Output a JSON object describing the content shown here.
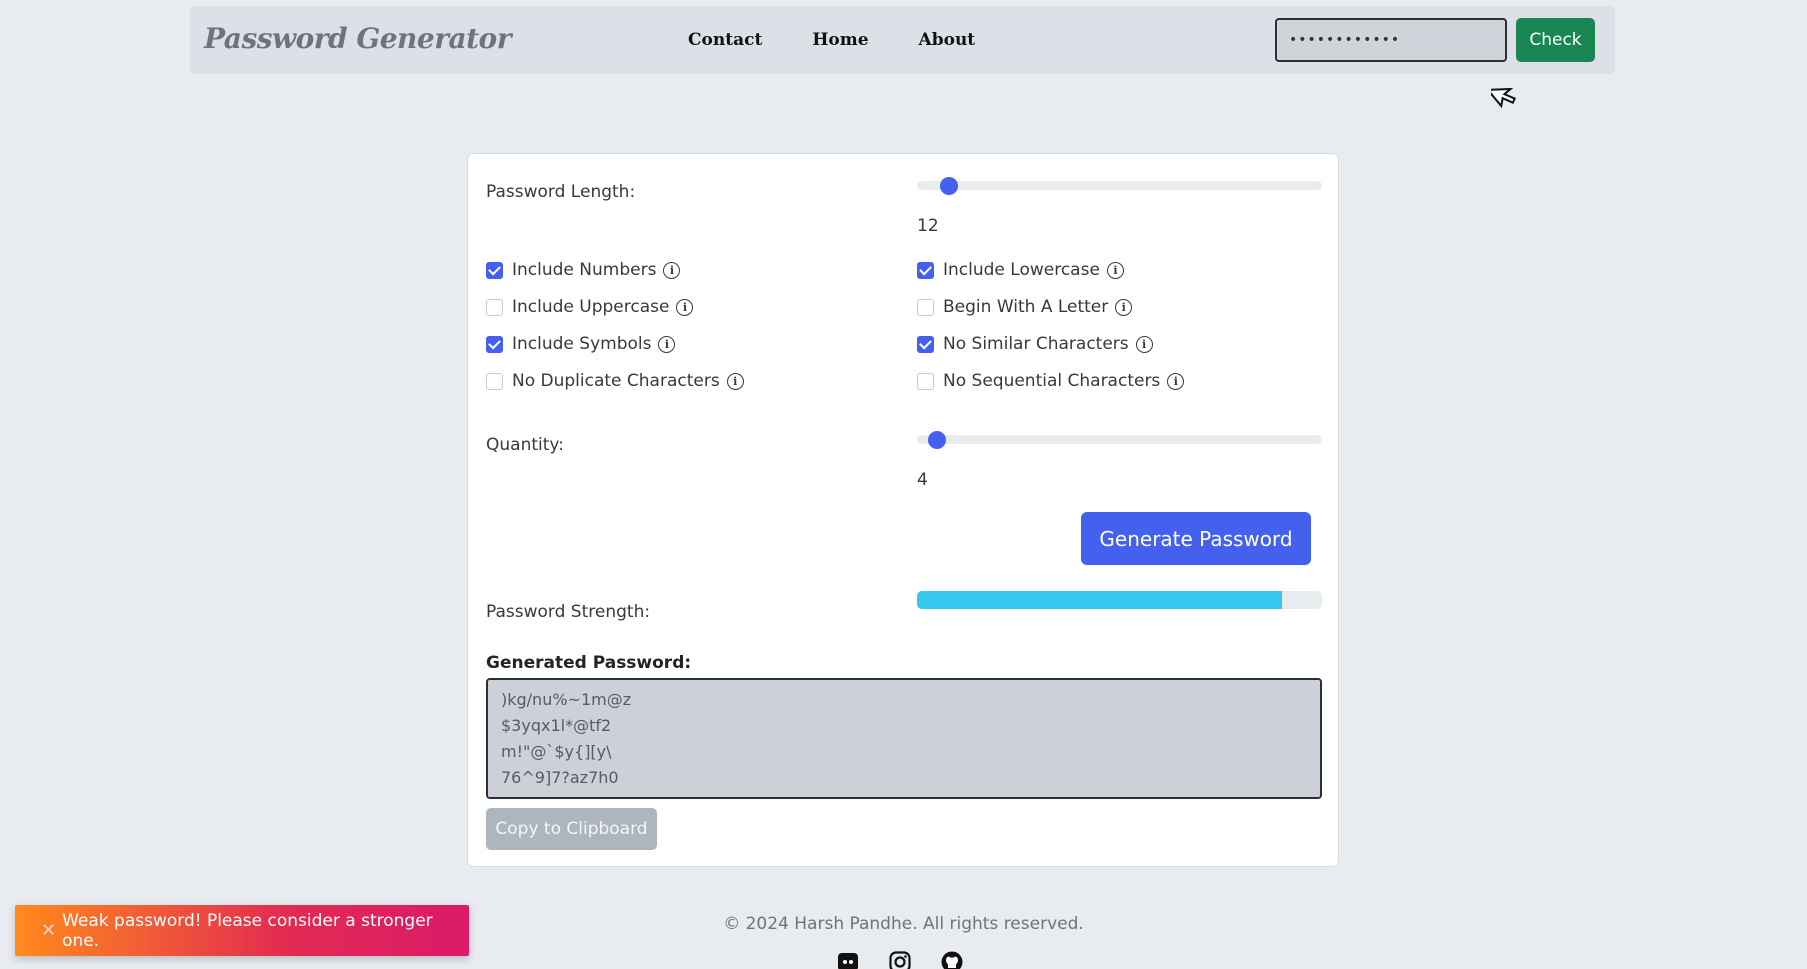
{
  "navbar": {
    "brand": "Password Generator",
    "links": [
      "Contact",
      "Home",
      "About"
    ],
    "check_input_value": "••••••••••••",
    "check_button": "Check"
  },
  "form": {
    "length_label": "Password Length:",
    "length_value": "12",
    "length_fraction": 0.08,
    "options": [
      {
        "label": "Include Numbers",
        "checked": true
      },
      {
        "label": "Include Lowercase",
        "checked": true
      },
      {
        "label": "Include Uppercase",
        "checked": false
      },
      {
        "label": "Begin With A Letter",
        "checked": false
      },
      {
        "label": "Include Symbols",
        "checked": true
      },
      {
        "label": "No Similar Characters",
        "checked": true
      },
      {
        "label": "No Duplicate Characters",
        "checked": false
      },
      {
        "label": "No Sequential Characters",
        "checked": false
      }
    ],
    "quantity_label": "Quantity:",
    "quantity_value": "4",
    "quantity_fraction": 0.05,
    "generate_button": "Generate Password",
    "strength_label": "Password Strength:",
    "strength_fraction": 0.9,
    "generated_label": "Generated Password:",
    "generated_passwords": ")kg/nu%~1m@z\n$3yqx1l*@tf2\nm!\"@`$y{][y\\\n76^9]7?az7h0",
    "copy_button": "Copy to Clipboard"
  },
  "footer": {
    "copyright": "© 2024 Harsh Pandhe. All rights reserved.",
    "socials": [
      "discord-icon",
      "instagram-icon",
      "github-icon"
    ]
  },
  "toast": {
    "icon": "✕",
    "message": "Weak password! Please consider a stronger one."
  },
  "colors": {
    "accent": "#4361ee",
    "check": "#198754",
    "strength": "#36c7ee"
  }
}
